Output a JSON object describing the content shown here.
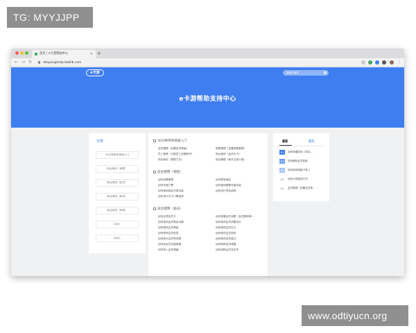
{
  "watermarks": {
    "top_left": "TG: MYYJJPP",
    "bottom_right": "www.odtiyucn.org"
  },
  "browser": {
    "tab_title": "首页 | e卡游帮助中心",
    "url": "ekayou@help.baklib.com"
  },
  "page": {
    "logo": "e卡游",
    "search_placeholder": "搜索关键词",
    "hero_title": "e卡游帮助支持中心",
    "accent": "#3f7ef0",
    "sidebar": {
      "title": "分类",
      "items": [
        "30分钟带你快速入门",
        "前台使用（销售）",
        "前台使用（会员）",
        "前台使用（库存）",
        "前台使用（其他）",
        "后台1",
        "后台2"
      ]
    },
    "sections": [
      {
        "title": "30分钟带你快速入门",
        "links": [
          "会员管理（设置会员等级）",
          "销售管理（设置销售套餐）",
          "员工管理（分配员工权限账号）",
          "前台使用（会员办卡）",
          "前台使用（零售方法）",
          "前台管理（每天交接入账）"
        ]
      },
      {
        "title": "前台使用（销售）",
        "links": [
          "如何消费管理",
          "如何售卖商品",
          "如何充值门票",
          "如何使用套餐充值功能",
          "如何使用商品兑换功能",
          "如何进行项目结算",
          "如何进行次卡门票结算"
        ]
      },
      {
        "title": "前台使用（会员）",
        "links": [
          "如何办理会员卡",
          "如何查看会员消费（会员删除掉…",
          "如何查询会员剩余余额",
          "如何查询会员消费流水",
          "如何更改会员等级",
          "如何更改会员生日",
          "如何修改会员信息",
          "如何修改会员密码",
          "如何延长会员有效期",
          "如何修改会员备注",
          "如何给会员充值增值",
          "如何转换会员储值",
          "如何导入会员储值",
          "如何减除会员支持币"
        ]
      }
    ],
    "right_panel": {
      "tabs": [
        "最新",
        "最热"
      ],
      "items": [
        {
          "num": "01",
          "text": "如何转赠游戏（前后…"
        },
        {
          "num": "02",
          "text": "如何删除会员档案"
        },
        {
          "num": "03",
          "text": "如何使用储值卡导入"
        },
        {
          "num": "04",
          "text": "如何计算提成方式"
        },
        {
          "num": "05",
          "text": "会员管理（设置会员等…"
        }
      ],
      "num_colors": [
        "#3f7ef0",
        "#6e9df3",
        "#a6c2f7"
      ]
    }
  }
}
